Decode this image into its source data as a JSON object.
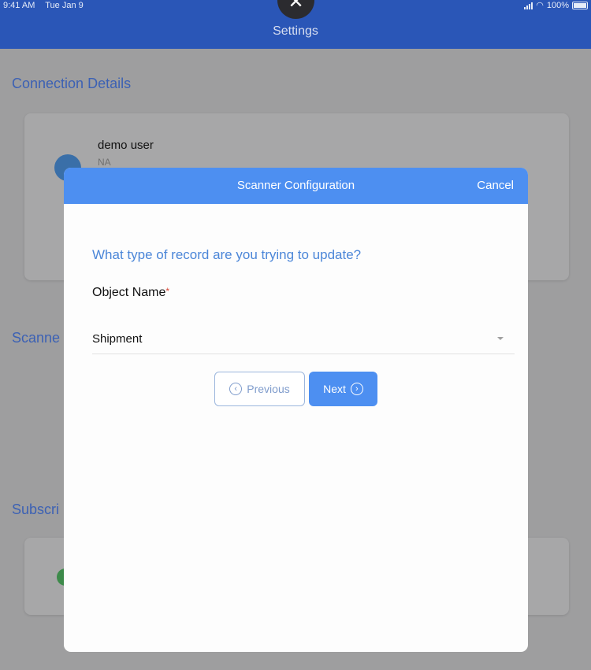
{
  "status_bar": {
    "time": "9:41 AM",
    "date": "Tue Jan 9",
    "battery": "100%"
  },
  "header": {
    "title": "Settings"
  },
  "close_glyph": "✕",
  "background": {
    "connection_title": "Connection Details",
    "user_name": "demo user",
    "user_sub": "NA",
    "scanner_title_partial": "Scanne",
    "subscription_title_partial": "Subscri"
  },
  "modal": {
    "title": "Scanner Configuration",
    "cancel_label": "Cancel",
    "question": "What type of record are you trying to update?",
    "field_label": "Object Name",
    "required_mark": "*",
    "selected_value": "Shipment",
    "previous_label": "Previous",
    "next_label": "Next",
    "previous_icon_glyph": "‹",
    "next_icon_glyph": "›"
  },
  "colors": {
    "header_bg": "#2a56b7",
    "modal_header_bg": "#4d8ff1",
    "accent_text": "#4b86d8",
    "required": "#d94a3a"
  },
  "icons": [
    "close-icon",
    "chevron-left-circle-icon",
    "chevron-right-circle-icon",
    "dropdown-arrow-icon",
    "wifi-icon",
    "battery-icon",
    "signal-icon"
  ]
}
